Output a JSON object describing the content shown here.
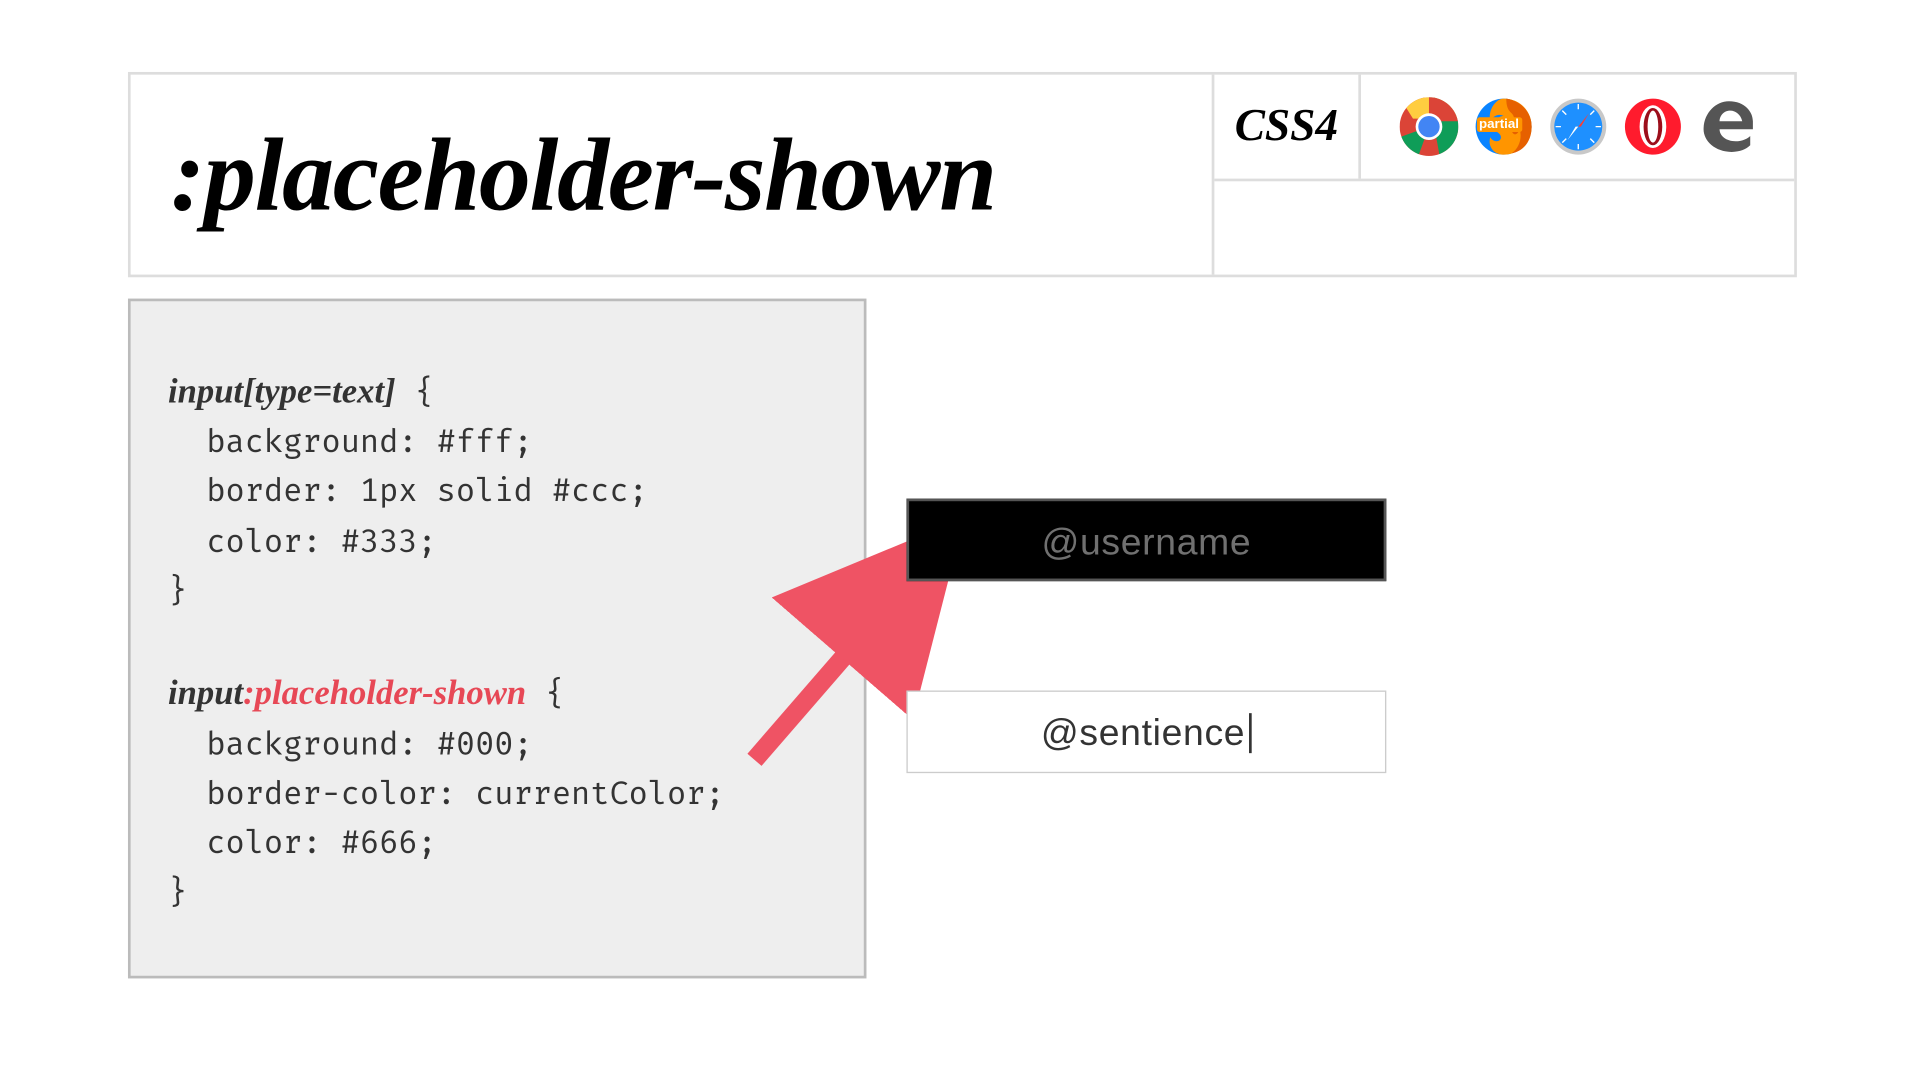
{
  "header": {
    "title": ":placeholder-shown",
    "badge": "CSS4",
    "browsers": [
      {
        "id": "chrome",
        "support": "full"
      },
      {
        "id": "firefox",
        "support": "partial",
        "label": "partial"
      },
      {
        "id": "safari",
        "support": "full"
      },
      {
        "id": "opera",
        "support": "full"
      },
      {
        "id": "edge",
        "support": "full"
      }
    ]
  },
  "code": {
    "rule1_selector": "input[type=text]",
    "rule1_body": "  background: #fff;\n  border: 1px solid #ccc;\n  color: #333;",
    "rule2_selector_prefix": "input",
    "rule2_pseudo": ":placeholder-shown",
    "rule2_body": "  background: #000;\n  border-color: currentColor;\n  color: #666;"
  },
  "demo": {
    "placeholder_text": "@username",
    "filled_text": "@sentience"
  }
}
